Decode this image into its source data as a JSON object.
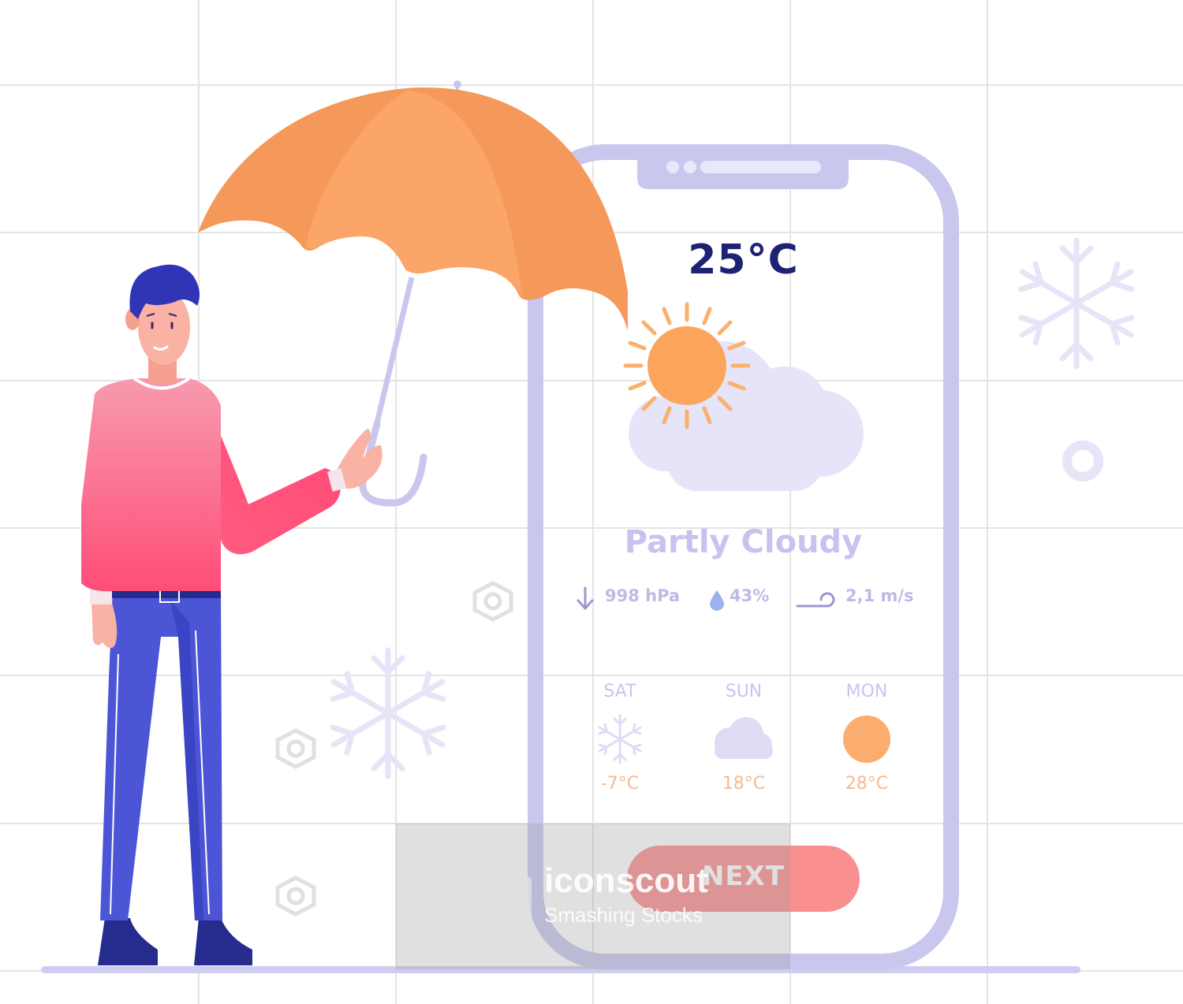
{
  "weather": {
    "temperature": "25°C",
    "condition": "Partly Cloudy",
    "pressure": "998 hPa",
    "humidity": "43%",
    "wind": "2,1 m/s"
  },
  "forecast": [
    {
      "day": "SAT",
      "icon": "snowflake-icon",
      "temp": "-7°C"
    },
    {
      "day": "SUN",
      "icon": "cloud-icon",
      "temp": "18°C"
    },
    {
      "day": "MON",
      "icon": "sun-icon",
      "temp": "28°C"
    }
  ],
  "button": {
    "label": "NEXT"
  },
  "watermark": {
    "brand": "iconscout",
    "tagline": "Smashing Stocks"
  },
  "colors": {
    "phone_frame": "#c9c7ee",
    "umbrella": "#f7a05e",
    "sweater": "#fa5d80",
    "pants": "#4b55d6",
    "hair": "#2f35b4",
    "accent_text": "#1e2272",
    "button": "#f98f8f"
  }
}
